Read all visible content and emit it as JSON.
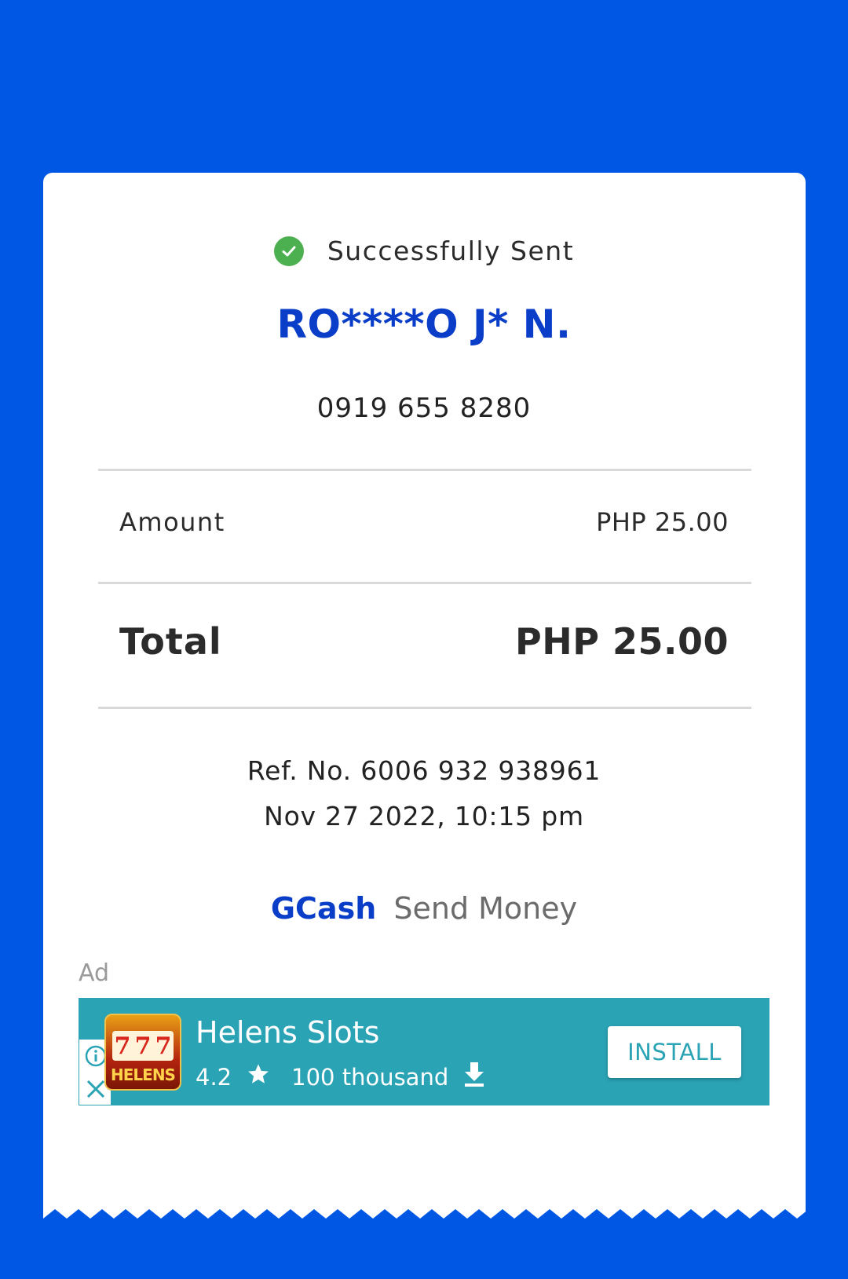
{
  "receipt": {
    "status_text": "Successfully Sent",
    "recipient_name": "RO****O J* N.",
    "recipient_number": "0919 655 8280",
    "amount_label": "Amount",
    "amount_value": "PHP 25.00",
    "total_label": "Total",
    "total_value": "PHP 25.00",
    "ref_no": "Ref. No. 6006 932 938961",
    "datetime": "Nov 27 2022, 10:15 pm",
    "brand_name": "GCash",
    "service_name": "Send Money"
  },
  "ad": {
    "label": "Ad",
    "app_name": "Helens Slots",
    "rating": "4.2",
    "installs": "100 thousand",
    "install_button": "INSTALL",
    "icon_text": "HELENS",
    "reels": [
      "7",
      "7",
      "7"
    ]
  },
  "colors": {
    "background": "#0057e4",
    "brand_blue": "#0a3ec9",
    "success_green": "#4caf50",
    "ad_teal": "#2aa3b5"
  },
  "icons": [
    "check-circle-icon",
    "star-icon",
    "download-icon",
    "ad-info-icon",
    "ad-close-icon"
  ]
}
